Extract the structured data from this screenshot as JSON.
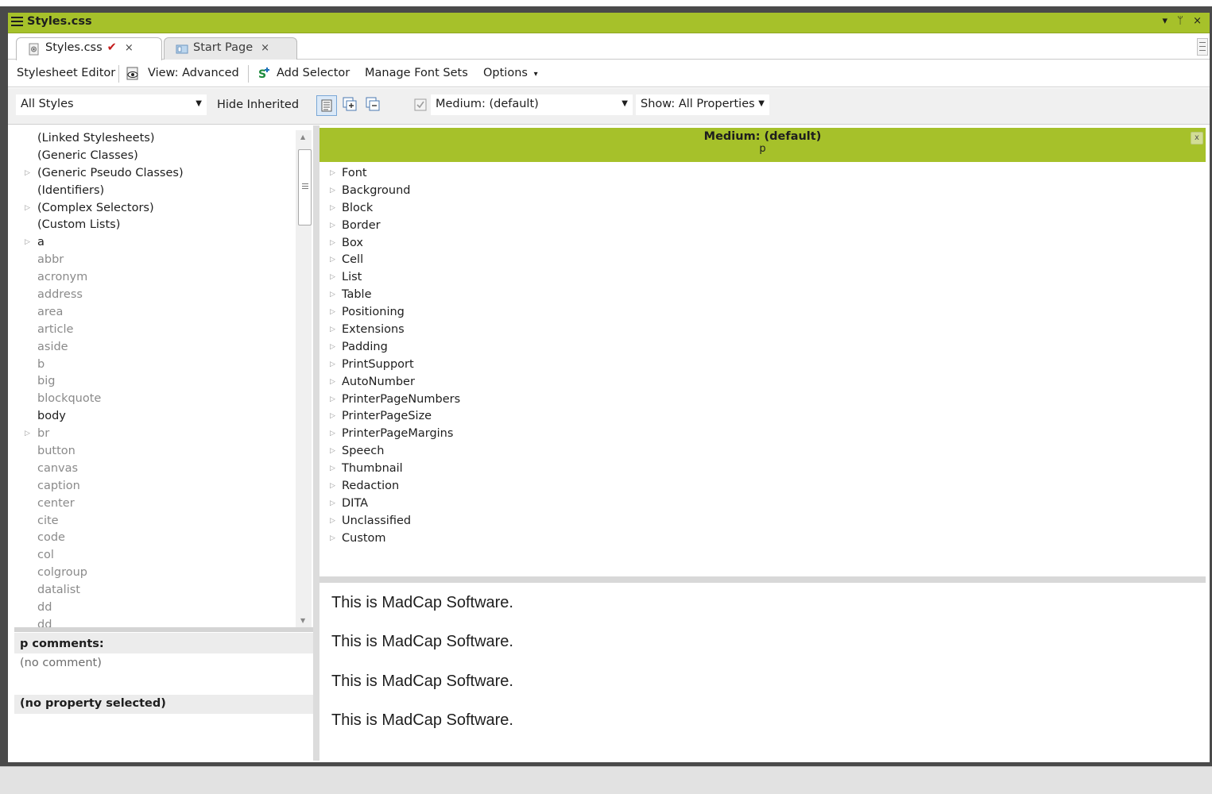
{
  "window": {
    "title": "Styles.css",
    "menu_icon": "menu-lines-icon",
    "controls": "▾ ᛘ ×"
  },
  "tabs": [
    {
      "label": "Styles.css",
      "modified_mark": "✔",
      "close": "×",
      "icon": "css-file-icon",
      "active": true
    },
    {
      "label": "Start Page",
      "close": "×",
      "icon": "start-page-icon",
      "active": false
    }
  ],
  "toolbar1": {
    "editor_label": "Stylesheet Editor",
    "view_label": "View: Advanced",
    "view_icon": "eye-view-icon",
    "add_selector_label": "Add Selector",
    "add_selector_icon": "add-selector-icon",
    "font_sets_label": "Manage Font Sets",
    "options_label": "Options",
    "options_arrow": "▾"
  },
  "toolbar2": {
    "styles_filter": "All Styles",
    "hide_inherited": "Hide Inherited",
    "medium_value": "Medium: (default)",
    "show_label": "Show: All Properties",
    "dropdown_arrow": "▼"
  },
  "tree": [
    {
      "label": "(Linked Stylesheets)",
      "defined": true,
      "expandable": false
    },
    {
      "label": "(Generic Classes)",
      "defined": true,
      "expandable": false
    },
    {
      "label": "(Generic Pseudo Classes)",
      "defined": true,
      "expandable": true
    },
    {
      "label": "(Identifiers)",
      "defined": true,
      "expandable": false
    },
    {
      "label": "(Complex Selectors)",
      "defined": true,
      "expandable": true
    },
    {
      "label": "(Custom Lists)",
      "defined": true,
      "expandable": false
    },
    {
      "label": "a",
      "defined": true,
      "expandable": true
    },
    {
      "label": "abbr",
      "defined": false,
      "expandable": false
    },
    {
      "label": "acronym",
      "defined": false,
      "expandable": false
    },
    {
      "label": "address",
      "defined": false,
      "expandable": false
    },
    {
      "label": "area",
      "defined": false,
      "expandable": false
    },
    {
      "label": "article",
      "defined": false,
      "expandable": false
    },
    {
      "label": "aside",
      "defined": false,
      "expandable": false
    },
    {
      "label": "b",
      "defined": false,
      "expandable": false
    },
    {
      "label": "big",
      "defined": false,
      "expandable": false
    },
    {
      "label": "blockquote",
      "defined": false,
      "expandable": false
    },
    {
      "label": "body",
      "defined": true,
      "expandable": false
    },
    {
      "label": "br",
      "defined": false,
      "expandable": true
    },
    {
      "label": "button",
      "defined": false,
      "expandable": false
    },
    {
      "label": "canvas",
      "defined": false,
      "expandable": false
    },
    {
      "label": "caption",
      "defined": false,
      "expandable": false
    },
    {
      "label": "center",
      "defined": false,
      "expandable": false
    },
    {
      "label": "cite",
      "defined": false,
      "expandable": false
    },
    {
      "label": "code",
      "defined": false,
      "expandable": false
    },
    {
      "label": "col",
      "defined": false,
      "expandable": false
    },
    {
      "label": "colgroup",
      "defined": false,
      "expandable": false
    },
    {
      "label": "datalist",
      "defined": false,
      "expandable": false
    },
    {
      "label": "dd",
      "defined": false,
      "expandable": false
    },
    {
      "label": "dd",
      "defined": false,
      "expandable": false
    }
  ],
  "comments": {
    "header": "p comments:",
    "body": "(no comment)"
  },
  "property": {
    "header": "(no property selected)"
  },
  "medium_panel": {
    "title": "Medium: (default)",
    "selector": "p",
    "close": "x"
  },
  "property_groups": [
    "Font",
    "Background",
    "Block",
    "Border",
    "Box",
    "Cell",
    "List",
    "Table",
    "Positioning",
    "Extensions",
    "Padding",
    "PrintSupport",
    "AutoNumber",
    "PrinterPageNumbers",
    "PrinterPageSize",
    "PrinterPageMargins",
    "Speech",
    "Thumbnail",
    "Redaction",
    "DITA",
    "Unclassified",
    "Custom"
  ],
  "preview": [
    "This is MadCap Software.",
    "This is MadCap Software.",
    "This is MadCap Software.",
    "This is MadCap Software."
  ],
  "colors": {
    "accent": "#a6c12a",
    "check_mark": "#c41a1a"
  }
}
